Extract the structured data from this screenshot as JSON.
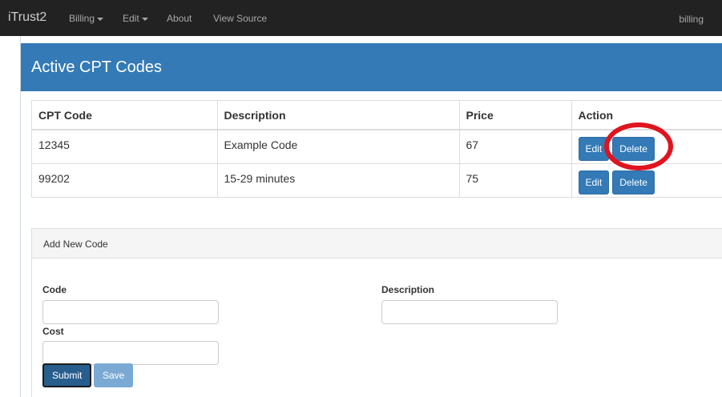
{
  "navbar": {
    "brand": "iTrust2",
    "items": [
      {
        "label": "Billing",
        "dropdown": true
      },
      {
        "label": "Edit",
        "dropdown": true
      },
      {
        "label": "About",
        "dropdown": false
      },
      {
        "label": "View Source",
        "dropdown": false
      }
    ],
    "user": "billing"
  },
  "panel": {
    "title": "Active CPT Codes"
  },
  "table": {
    "headers": [
      "CPT Code",
      "Description",
      "Price",
      "Action"
    ],
    "rows": [
      {
        "code": "12345",
        "description": "Example Code",
        "price": "67",
        "edit": "Edit",
        "delete": "Delete"
      },
      {
        "code": "99202",
        "description": "15-29 minutes",
        "price": "75",
        "edit": "Edit",
        "delete": "Delete"
      }
    ]
  },
  "add_form": {
    "heading": "Add New Code",
    "code_label": "Code",
    "description_label": "Description",
    "cost_label": "Cost",
    "code_value": "",
    "description_value": "",
    "cost_value": "",
    "submit_label": "Submit",
    "save_label": "Save"
  },
  "colors": {
    "navbar": "#222222",
    "primary": "#337ab7",
    "annotation": "#e0141e"
  }
}
